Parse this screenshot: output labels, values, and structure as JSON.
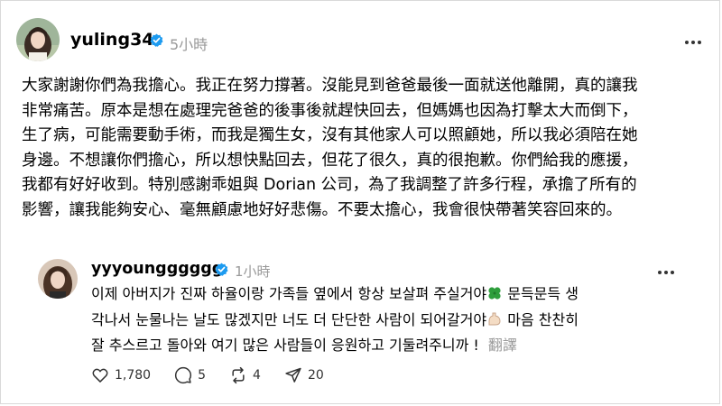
{
  "post": {
    "username": "yuling34",
    "time": "5小時",
    "more_icon": "more-horizontal-icon",
    "lines": [
      "大家謝謝你們為我擔心。我正在努力撐著。沒能見到爸爸最後一面就送他離開，真的讓我",
      "非常痛苦。原本是想在處理完爸爸的後事後就趕快回去，但媽媽也因為打擊太大而倒下，",
      "生了病，可能需要動手術，而我是獨生女，沒有其他家人可以照顧她，所以我必須陪在她",
      "身邊。不想讓你們擔心，所以想快點回去，但花了很久，真的很抱歉。你們給我的應援，",
      "我都有好好收到。特別感謝乖姐與 Dorian 公司，為了我調整了許多行程，承擔了所有的",
      "影響，讓我能夠安心、毫無顧慮地好好悲傷。不要太擔心，我會很快帶著笑容回來的。"
    ]
  },
  "reply": {
    "username": "yyyoungggggg",
    "time": "1小時",
    "line1": "이제 아버지가 진짜 하율이랑 가족들 옆에서 항상 보살펴 주실거야",
    "line1b": " 문득문득 생",
    "line2": "각나서 눈물나는 날도 많겠지만 너도 더 단단한 사람이 되어갈거야",
    "line2b": " 마음 찬찬히",
    "line3": "잘 추스르고 돌아와 여기 많은 사람들이 응원하고 기둘려주니까 !",
    "translate": "翻譯",
    "emoji1": "four-leaf-clover-icon",
    "emoji2": "flexed-biceps-icon"
  },
  "actions": {
    "likes": "1,780",
    "comments": "5",
    "reposts": "4",
    "shares": "20"
  },
  "colors": {
    "verified": "#1d9bf0",
    "muted": "#999999"
  }
}
